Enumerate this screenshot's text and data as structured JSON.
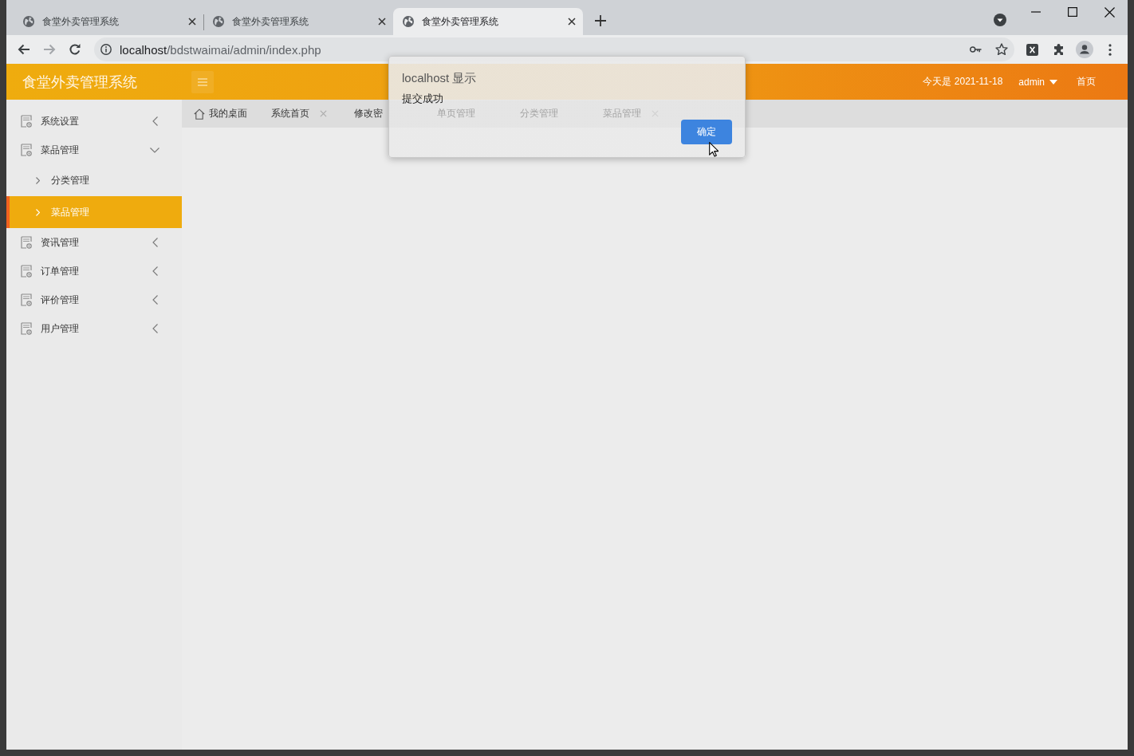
{
  "browser": {
    "tabs": [
      {
        "title": "食堂外卖管理系统",
        "selected": false
      },
      {
        "title": "食堂外卖管理系统",
        "selected": false
      },
      {
        "title": "食堂外卖管理系统",
        "selected": true
      }
    ],
    "address": {
      "host": "localhost",
      "path": "/bdstwaimai/admin/index.php"
    }
  },
  "header": {
    "title": "食堂外卖管理系统",
    "date": "今天是 2021-11-18",
    "user": "admin",
    "home_link": "首页"
  },
  "sidebar": {
    "items": [
      {
        "label": "系统设置",
        "selected": false,
        "expanded": false
      },
      {
        "label": "菜品管理",
        "selected": false,
        "expanded": true,
        "children": [
          {
            "label": "分类管理",
            "selected": false
          },
          {
            "label": "菜品管理",
            "selected": true
          }
        ]
      },
      {
        "label": "资讯管理",
        "selected": false,
        "expanded": false
      },
      {
        "label": "订单管理",
        "selected": false,
        "expanded": false
      },
      {
        "label": "评价管理",
        "selected": false,
        "expanded": false
      },
      {
        "label": "用户管理",
        "selected": false,
        "expanded": false
      }
    ]
  },
  "page_tabs": [
    {
      "label": "我的桌面",
      "kind": "home",
      "closable": false
    },
    {
      "label": "系统首页",
      "kind": "page",
      "closable": true
    },
    {
      "label": "修改密",
      "kind": "page",
      "closable": false
    },
    {
      "label": "单页管理",
      "kind": "page",
      "closable": false
    },
    {
      "label": "分类管理",
      "kind": "page",
      "closable": false
    },
    {
      "label": "菜品管理",
      "kind": "page",
      "closable": true
    }
  ],
  "dialog": {
    "title": "localhost 显示",
    "message": "提交成功",
    "button": "确定"
  }
}
